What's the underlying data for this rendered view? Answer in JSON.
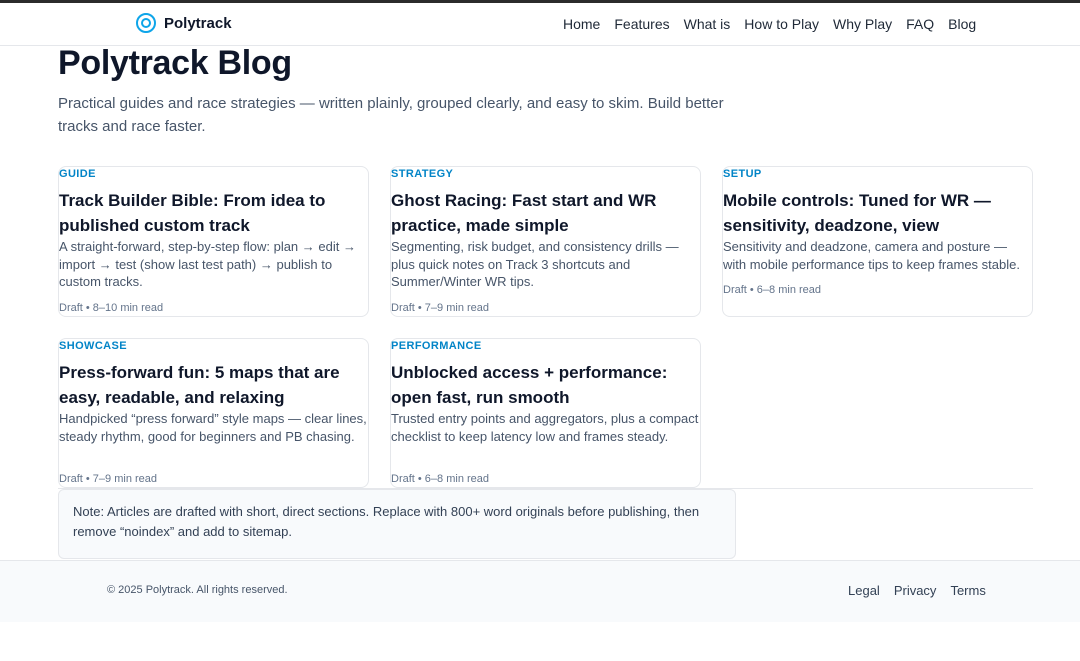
{
  "brand": {
    "name": "Polytrack",
    "logo_icon": "target-icon",
    "accent": "#0ea5e9"
  },
  "nav": [
    "Home",
    "Features",
    "What is",
    "How to Play",
    "Why Play",
    "FAQ",
    "Blog"
  ],
  "page": {
    "title": "Polytrack Blog",
    "intro": "Practical guides and race strategies — written plainly, grouped clearly, and easy to skim. Build better tracks and race faster."
  },
  "cards": [
    {
      "tag": "GUIDE",
      "title": "Track Builder Bible: From idea to published custom track",
      "desc": "A straight-forward, step-by-step flow: plan → edit → import → test (show last test path) → publish to custom tracks.",
      "meta": "Draft • 8–10 min read"
    },
    {
      "tag": "STRATEGY",
      "title": "Ghost Racing: Fast start and WR practice, made simple",
      "desc": "Segmenting, risk budget, and consistency drills — plus quick notes on Track 3 shortcuts and Summer/Winter WR tips.",
      "meta": "Draft • 7–9 min read"
    },
    {
      "tag": "SETUP",
      "title": "Mobile controls: Tuned for WR — sensitivity, deadzone, view",
      "desc": "Sensitivity and deadzone, camera and posture — with mobile performance tips to keep frames stable.",
      "meta": "Draft • 6–8 min read"
    },
    {
      "tag": "SHOWCASE",
      "title": "Press-forward fun: 5 maps that are easy, readable, and relaxing",
      "desc": "Handpicked “press forward” style maps — clear lines, steady rhythm, good for beginners and PB chasing.",
      "meta": "Draft • 7–9 min read"
    },
    {
      "tag": "PERFORMANCE",
      "title": "Unblocked access + performance: open fast, run smooth",
      "desc": "Trusted entry points and aggregators, plus a compact checklist to keep latency low and frames steady.",
      "meta": "Draft • 6–8 min read"
    }
  ],
  "note": "Note: Articles are drafted with short, direct sections. Replace with 800+ word originals before publishing, then remove “noindex” and add to sitemap.",
  "footer": {
    "copyright": "© 2025 Polytrack. All rights reserved.",
    "links": [
      "Legal",
      "Privacy",
      "Terms"
    ]
  }
}
